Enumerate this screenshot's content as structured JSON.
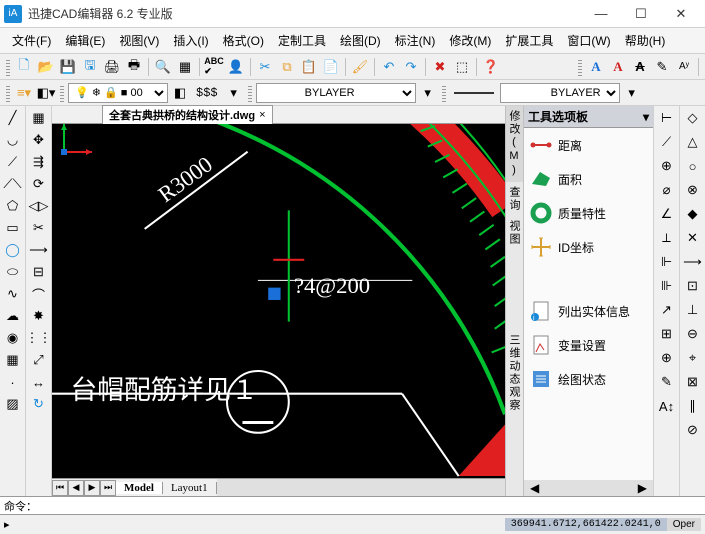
{
  "window": {
    "title": "迅捷CAD编辑器 6.2 专业版",
    "app_icon_text": "iA"
  },
  "menu": {
    "file": "文件(F)",
    "edit": "编辑(E)",
    "view": "视图(V)",
    "insert": "插入(I)",
    "format": "格式(O)",
    "custom": "定制工具",
    "draw": "绘图(D)",
    "dim": "标注(N)",
    "modify": "修改(M)",
    "ext": "扩展工具",
    "window": "窗口(W)",
    "help": "帮助(H)"
  },
  "layer_combo": "0",
  "linetype_label": "$$$",
  "bylayer1": "BYLAYER",
  "bylayer2": "BYLAYER",
  "text_style": {
    "A_blue": "A",
    "A_red": "A",
    "A_cross": "A"
  },
  "doc_tab": "全套古典拱桥的结构设计.dwg",
  "canvas_text": {
    "r3000": "R3000",
    "dim": "?4@200",
    "note": "台帽配筋详见１"
  },
  "model_tabs": {
    "model": "Model",
    "layout1": "Layout1"
  },
  "palette": {
    "title": "工具选项板",
    "tabs": {
      "modify": "修改(M)",
      "inquiry": "查询",
      "view": "视图",
      "dyn": "三维动态观察"
    },
    "items": {
      "distance": "距离",
      "area": "面积",
      "mass": "质量特性",
      "idpoint": "ID坐标",
      "listent": "列出实体信息",
      "setvar": "变量设置",
      "drawstat": "绘图状态"
    }
  },
  "cmdline_prompt": "命令：",
  "status": {
    "coords": "369941.6712,661422.0241,0",
    "oper": "Oper"
  }
}
